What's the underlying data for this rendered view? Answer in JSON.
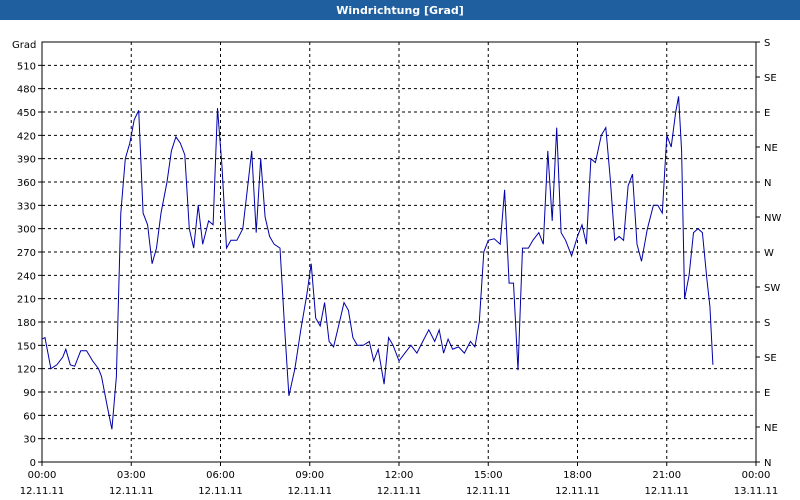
{
  "window": {
    "title": "Windrichtung [Grad]"
  },
  "chart_data": {
    "type": "line",
    "title": "Windrichtung [Grad]",
    "ylabel": "Grad",
    "ylim": [
      0,
      540
    ],
    "xlim_hours": [
      0,
      24
    ],
    "y_ticks": [
      0,
      30,
      60,
      90,
      120,
      150,
      180,
      210,
      240,
      270,
      300,
      330,
      360,
      390,
      420,
      450,
      480,
      510
    ],
    "right_axis_ticks": [
      {
        "value": 0,
        "label": "N"
      },
      {
        "value": 30,
        "label": "NE"
      },
      {
        "value": 60,
        "label": "E"
      },
      {
        "value": 90,
        "label": "SE"
      },
      {
        "value": 120,
        "label": "S"
      },
      {
        "value": 150,
        "label": "SW"
      },
      {
        "value": 180,
        "label": "W"
      },
      {
        "value": 210,
        "label": "NW"
      },
      {
        "value": 240,
        "label": "N"
      },
      {
        "value": 270,
        "label": "NE"
      },
      {
        "value": 300,
        "label": "E"
      },
      {
        "value": 330,
        "label": "SE"
      },
      {
        "value": 360,
        "label": "S"
      }
    ],
    "x_ticks": [
      {
        "hour": 0,
        "time": "00:00",
        "date": "12.11.11"
      },
      {
        "hour": 3,
        "time": "03:00",
        "date": "12.11.11"
      },
      {
        "hour": 6,
        "time": "06:00",
        "date": "12.11.11"
      },
      {
        "hour": 9,
        "time": "09:00",
        "date": "12.11.11"
      },
      {
        "hour": 12,
        "time": "12:00",
        "date": "12.11.11"
      },
      {
        "hour": 15,
        "time": "15:00",
        "date": "12.11.11"
      },
      {
        "hour": 18,
        "time": "18:00",
        "date": "12.11.11"
      },
      {
        "hour": 21,
        "time": "21:00",
        "date": "12.11.11"
      },
      {
        "hour": 24,
        "time": "00:00",
        "date": "13.11.11"
      }
    ],
    "grid": true,
    "series": [
      {
        "color": "#0000aa",
        "points": [
          [
            0.0,
            158
          ],
          [
            0.1,
            160
          ],
          [
            0.3,
            120
          ],
          [
            0.5,
            125
          ],
          [
            0.7,
            135
          ],
          [
            0.8,
            145
          ],
          [
            0.95,
            125
          ],
          [
            1.1,
            123
          ],
          [
            1.3,
            143
          ],
          [
            1.5,
            143
          ],
          [
            1.7,
            130
          ],
          [
            1.9,
            120
          ],
          [
            2.0,
            110
          ],
          [
            2.2,
            70
          ],
          [
            2.35,
            42
          ],
          [
            2.5,
            110
          ],
          [
            2.65,
            320
          ],
          [
            2.8,
            390
          ],
          [
            2.95,
            410
          ],
          [
            3.1,
            440
          ],
          [
            3.25,
            452
          ],
          [
            3.4,
            320
          ],
          [
            3.55,
            305
          ],
          [
            3.7,
            255
          ],
          [
            3.85,
            275
          ],
          [
            4.0,
            320
          ],
          [
            4.2,
            360
          ],
          [
            4.35,
            400
          ],
          [
            4.5,
            418
          ],
          [
            4.65,
            410
          ],
          [
            4.8,
            395
          ],
          [
            4.95,
            300
          ],
          [
            5.1,
            275
          ],
          [
            5.25,
            330
          ],
          [
            5.4,
            280
          ],
          [
            5.6,
            310
          ],
          [
            5.75,
            305
          ],
          [
            5.9,
            455
          ],
          [
            6.05,
            380
          ],
          [
            6.2,
            275
          ],
          [
            6.35,
            285
          ],
          [
            6.55,
            285
          ],
          [
            6.75,
            300
          ],
          [
            6.9,
            350
          ],
          [
            7.05,
            400
          ],
          [
            7.2,
            295
          ],
          [
            7.35,
            390
          ],
          [
            7.5,
            315
          ],
          [
            7.65,
            290
          ],
          [
            7.8,
            280
          ],
          [
            8.0,
            275
          ],
          [
            8.15,
            175
          ],
          [
            8.3,
            85
          ],
          [
            8.5,
            120
          ],
          [
            8.7,
            170
          ],
          [
            8.9,
            215
          ],
          [
            9.05,
            255
          ],
          [
            9.2,
            185
          ],
          [
            9.35,
            175
          ],
          [
            9.5,
            205
          ],
          [
            9.65,
            155
          ],
          [
            9.8,
            148
          ],
          [
            10.0,
            180
          ],
          [
            10.15,
            205
          ],
          [
            10.3,
            195
          ],
          [
            10.45,
            160
          ],
          [
            10.6,
            150
          ],
          [
            10.8,
            150
          ],
          [
            11.0,
            155
          ],
          [
            11.15,
            130
          ],
          [
            11.3,
            145
          ],
          [
            11.5,
            100
          ],
          [
            11.65,
            160
          ],
          [
            11.8,
            150
          ],
          [
            12.0,
            130
          ],
          [
            12.2,
            140
          ],
          [
            12.4,
            150
          ],
          [
            12.6,
            140
          ],
          [
            12.8,
            155
          ],
          [
            13.0,
            170
          ],
          [
            13.2,
            155
          ],
          [
            13.35,
            170
          ],
          [
            13.5,
            140
          ],
          [
            13.65,
            158
          ],
          [
            13.8,
            145
          ],
          [
            14.0,
            148
          ],
          [
            14.2,
            140
          ],
          [
            14.4,
            155
          ],
          [
            14.55,
            148
          ],
          [
            14.7,
            180
          ],
          [
            14.85,
            270
          ],
          [
            15.0,
            285
          ],
          [
            15.2,
            287
          ],
          [
            15.4,
            280
          ],
          [
            15.55,
            350
          ],
          [
            15.7,
            230
          ],
          [
            15.85,
            230
          ],
          [
            16.0,
            118
          ],
          [
            16.15,
            275
          ],
          [
            16.35,
            275
          ],
          [
            16.5,
            285
          ],
          [
            16.7,
            295
          ],
          [
            16.85,
            280
          ],
          [
            17.0,
            400
          ],
          [
            17.15,
            310
          ],
          [
            17.3,
            430
          ],
          [
            17.45,
            295
          ],
          [
            17.6,
            285
          ],
          [
            17.8,
            265
          ],
          [
            18.0,
            290
          ],
          [
            18.15,
            305
          ],
          [
            18.3,
            280
          ],
          [
            18.45,
            390
          ],
          [
            18.6,
            385
          ],
          [
            18.8,
            420
          ],
          [
            18.95,
            430
          ],
          [
            19.1,
            365
          ],
          [
            19.25,
            285
          ],
          [
            19.4,
            290
          ],
          [
            19.55,
            285
          ],
          [
            19.7,
            355
          ],
          [
            19.85,
            370
          ],
          [
            20.0,
            280
          ],
          [
            20.15,
            258
          ],
          [
            20.35,
            300
          ],
          [
            20.55,
            330
          ],
          [
            20.7,
            330
          ],
          [
            20.85,
            320
          ],
          [
            21.0,
            420
          ],
          [
            21.15,
            405
          ],
          [
            21.3,
            450
          ],
          [
            21.4,
            470
          ],
          [
            21.5,
            400
          ],
          [
            21.6,
            210
          ],
          [
            21.75,
            240
          ],
          [
            21.9,
            295
          ],
          [
            22.05,
            300
          ],
          [
            22.2,
            295
          ],
          [
            22.35,
            235
          ],
          [
            22.45,
            200
          ],
          [
            22.55,
            125
          ]
        ]
      }
    ]
  }
}
